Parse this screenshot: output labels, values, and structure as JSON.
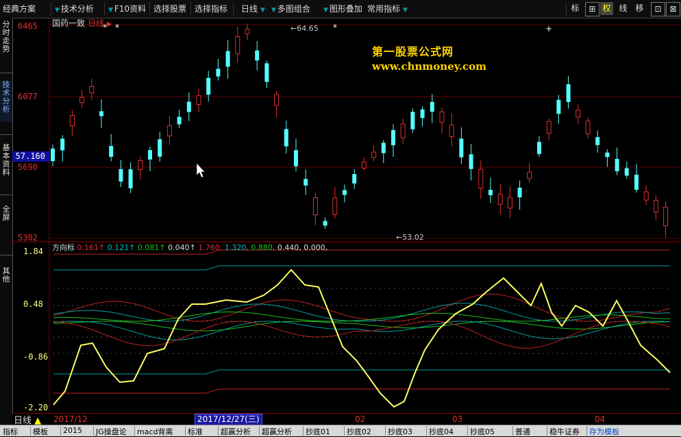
{
  "menu": {
    "items": [
      "经典方案",
      "技术分析",
      "F10资料",
      "选择股票",
      "选择指标",
      "日线",
      "多图组合",
      "图形叠加",
      "常用指标"
    ],
    "tools": [
      "标",
      "⊞",
      "权",
      "线",
      "移",
      "⊡",
      "⊠"
    ]
  },
  "left_tabs": [
    "分时走势",
    "技术分析",
    "基本资料",
    "全屏",
    "其他"
  ],
  "price_axis": {
    "labels": [
      "6465",
      "6077",
      "5690",
      "5302"
    ],
    "current": "57.160"
  },
  "chart_title": {
    "name": "国药一致",
    "period": "日线"
  },
  "annotations": {
    "high": "64.65",
    "low": "53.02"
  },
  "watermark": {
    "line1": "第一股票公式网",
    "line2": "www.chnmoney.com"
  },
  "indicator": {
    "name": "方向标",
    "values": [
      "0.161↑",
      "0.121↑",
      "0.081↑",
      "0.040↑",
      "1.760,",
      "1.320,",
      "0.880,",
      "0.440,",
      "0.000,"
    ],
    "value_colors": [
      "#e03030",
      "#00c0c0",
      "#20c020",
      "#dddddd",
      "#e03030",
      "#00c0c0",
      "#20c020",
      "#dddddd",
      "#dddddd"
    ],
    "axis_labels": [
      "1.84",
      "0.48",
      "-0.86",
      "-2.20"
    ]
  },
  "date_axis": {
    "labels": [
      "2017/12",
      "02",
      "03",
      "04"
    ],
    "cursor": "2017/12/27(三)"
  },
  "period_label": "日线",
  "bottom_tabs": [
    "指标",
    "模板",
    "2015",
    "JG操盘论",
    "macd背离",
    "标准",
    "超赢分析",
    "超赢分析",
    "抄底01",
    "抄底02",
    "抄底03",
    "抄底04",
    "抄底05",
    "普通",
    "稳牛证券",
    "存为模板"
  ],
  "colors": {
    "up": "#e03030",
    "down": "#54ffff",
    "grid": "#5a0000",
    "indicator_main": "#ffff60"
  }
}
